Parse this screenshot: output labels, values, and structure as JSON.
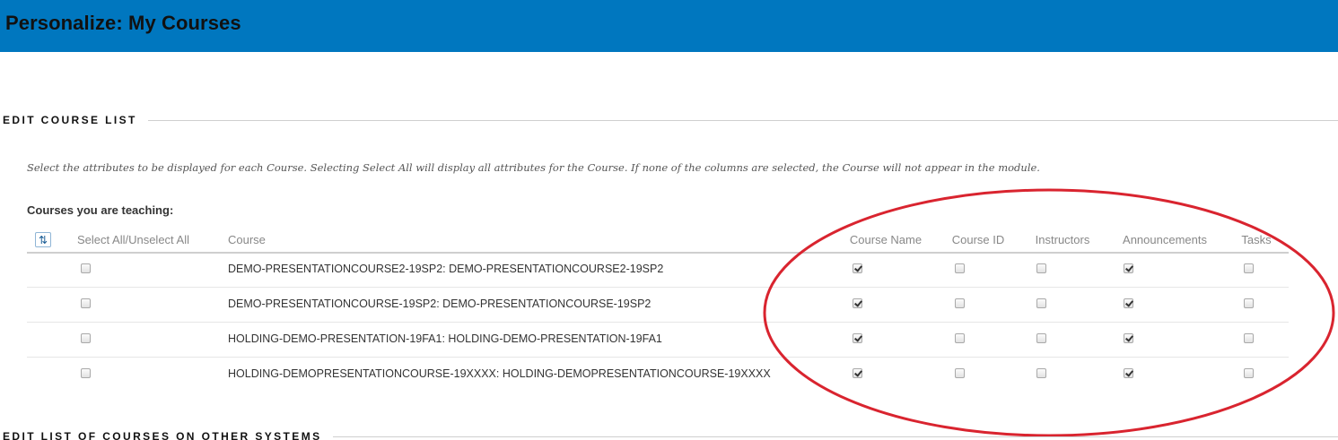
{
  "header": {
    "title": "Personalize: My Courses"
  },
  "section_edit_course_list": {
    "heading": "EDIT COURSE LIST"
  },
  "instructions": "Select the attributes to be displayed for each Course. Selecting Select All will display all attributes for the Course. If none of the columns are selected, the Course will not appear in the module.",
  "teaching_label": "Courses you are teaching:",
  "table": {
    "columns": {
      "select_all": "Select All/Unselect All",
      "course": "Course",
      "course_name": "Course Name",
      "course_id": "Course ID",
      "instructors": "Instructors",
      "announcements": "Announcements",
      "tasks": "Tasks"
    },
    "rows": [
      {
        "course": "DEMO-PRESENTATIONCOURSE2-19SP2: DEMO-PRESENTATIONCOURSE2-19SP2",
        "select_all": false,
        "course_name": true,
        "course_id": false,
        "instructors": false,
        "announcements": true,
        "tasks": false
      },
      {
        "course": "DEMO-PRESENTATIONCOURSE-19SP2: DEMO-PRESENTATIONCOURSE-19SP2",
        "select_all": false,
        "course_name": true,
        "course_id": false,
        "instructors": false,
        "announcements": true,
        "tasks": false
      },
      {
        "course": "HOLDING-DEMO-PRESENTATION-19FA1: HOLDING-DEMO-PRESENTATION-19FA1",
        "select_all": false,
        "course_name": true,
        "course_id": false,
        "instructors": false,
        "announcements": true,
        "tasks": false
      },
      {
        "course": "HOLDING-DEMOPRESENTATIONCOURSE-19XXXX: HOLDING-DEMOPRESENTATIONCOURSE-19XXXX",
        "select_all": false,
        "course_name": true,
        "course_id": false,
        "instructors": false,
        "announcements": true,
        "tasks": false
      }
    ]
  },
  "section_other_systems": {
    "heading": "EDIT LIST OF COURSES ON OTHER SYSTEMS"
  },
  "icons": {
    "sort": "sort-toggle-icon",
    "check": "checkmark-icon"
  },
  "colors": {
    "header_bg": "#0077bf",
    "annotation": "#d9242f"
  }
}
